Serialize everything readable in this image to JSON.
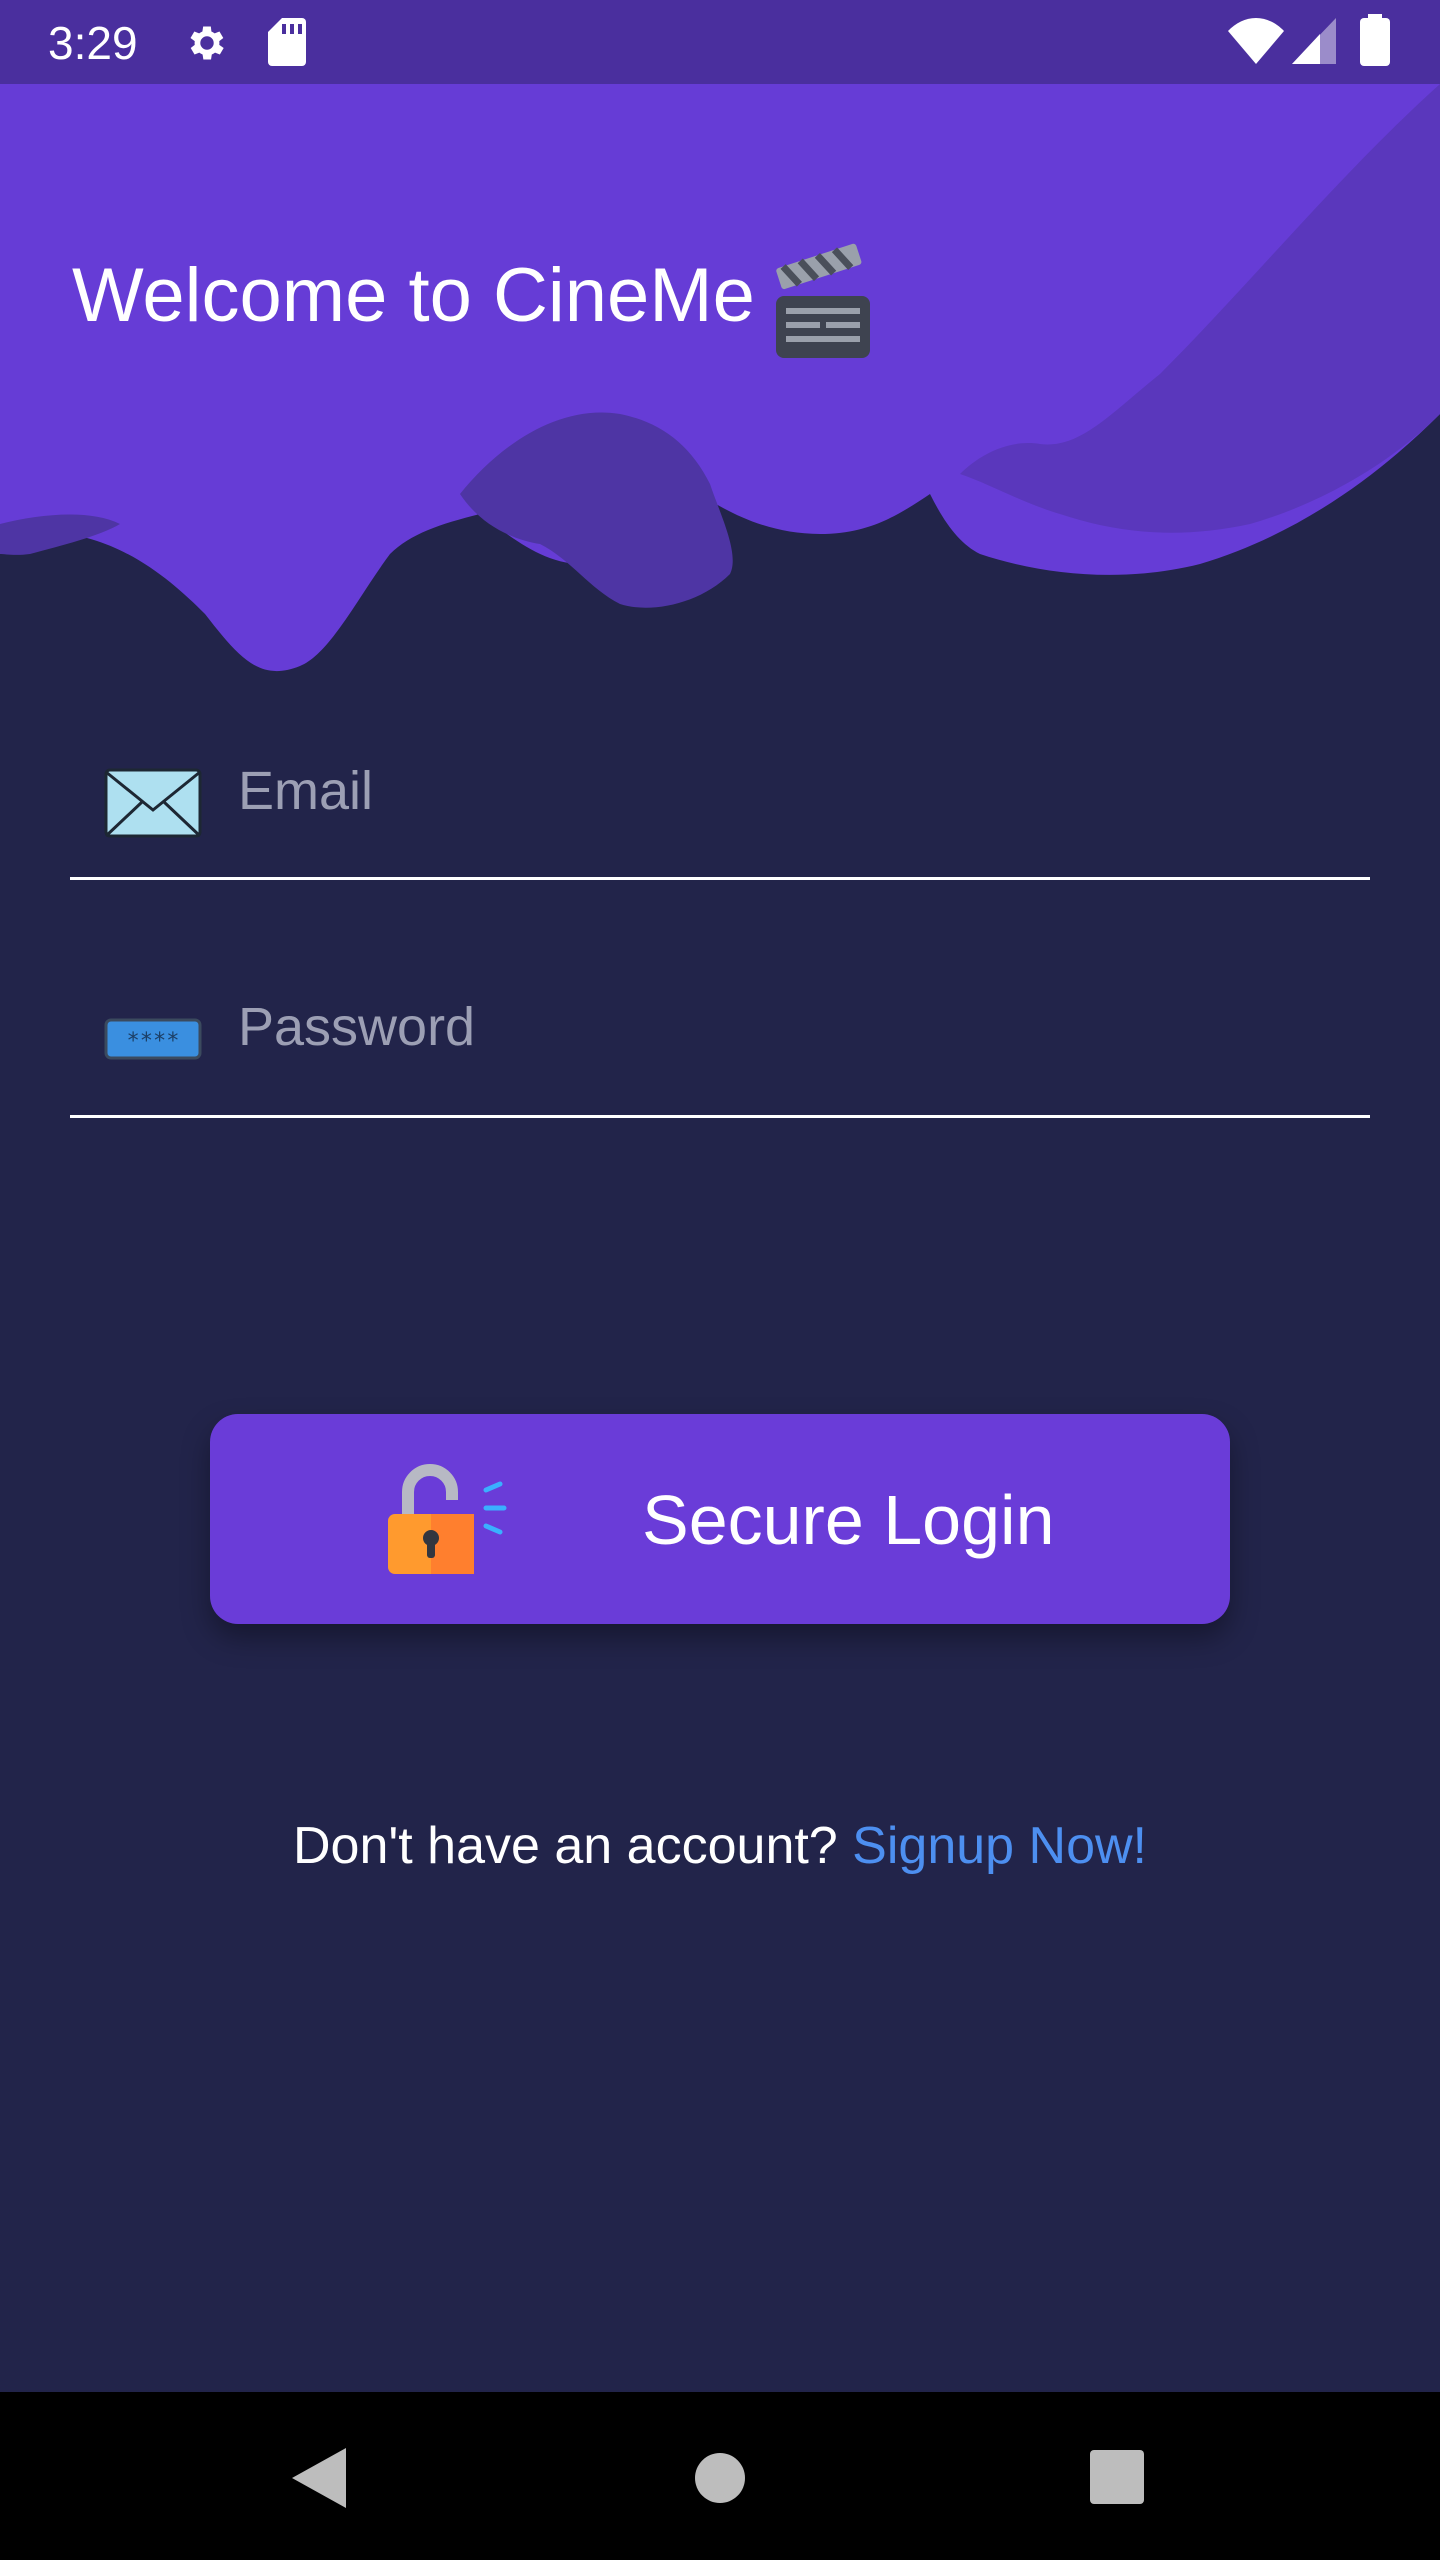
{
  "status_bar": {
    "time": "3:29",
    "icons": [
      "gear-icon",
      "sd-card-icon",
      "wifi-icon",
      "signal-icon",
      "battery-icon"
    ]
  },
  "header": {
    "title": "Welcome to CineMe",
    "title_icon": "clapper-board-icon"
  },
  "form": {
    "email": {
      "placeholder": "Email",
      "value": "",
      "icon": "envelope-icon"
    },
    "password": {
      "placeholder": "Password",
      "value": "",
      "icon": "password-icon"
    }
  },
  "login_button": {
    "label": "Secure Login",
    "icon": "unlocked-padlock-icon"
  },
  "signup": {
    "prompt": "Don't have an account? ",
    "link": "Signup Now!"
  },
  "nav_bar": {
    "icons": [
      "back-icon",
      "home-icon",
      "recents-icon"
    ]
  },
  "colors": {
    "background": "#22244a",
    "header_purple": "#663cd6",
    "status_bar": "#4a2f9e",
    "button": "#6a3cd8",
    "link": "#4d8ff0",
    "placeholder": "#9c9fb4"
  }
}
